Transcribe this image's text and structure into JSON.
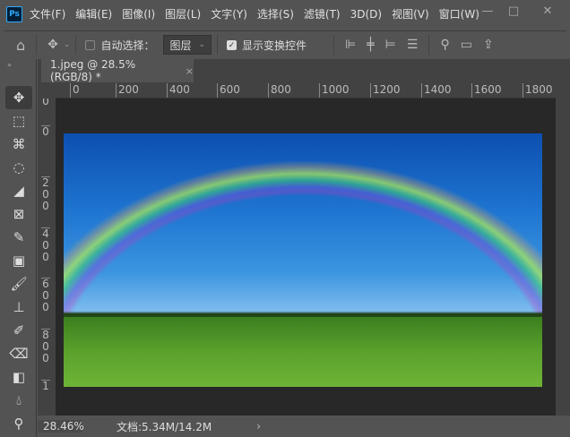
{
  "app": {
    "logo": "Ps"
  },
  "menu": [
    "文件(F)",
    "编辑(E)",
    "图像(I)",
    "图层(L)",
    "文字(Y)",
    "选择(S)",
    "滤镜(T)",
    "3D(D)",
    "视图(V)",
    "窗口(W)"
  ],
  "window_controls": {
    "minimize": "—",
    "maximize": "□",
    "close": "✕"
  },
  "options": {
    "auto_select_label": "自动选择：",
    "auto_select_checked": false,
    "layer_dropdown": "图层",
    "show_transform_label": "显示变换控件",
    "show_transform_checked": true
  },
  "tab": {
    "title": "1.jpeg @ 28.5%(RGB/8) *",
    "close": "×"
  },
  "hruler": [
    "0",
    "200",
    "400",
    "600",
    "800",
    "1000",
    "1200",
    "1400",
    "1600",
    "1800"
  ],
  "vruler": [
    "0",
    "0",
    "200",
    "400",
    "600",
    "800",
    "1"
  ],
  "status": {
    "zoom": "28.46%",
    "doc": "文档:5.34M/14.2M",
    "arrow": "›"
  }
}
